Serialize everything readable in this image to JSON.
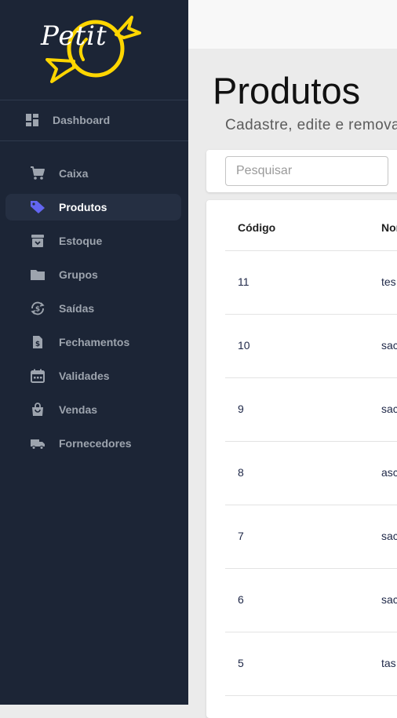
{
  "colors": {
    "sidebar_bg": "#1c2536",
    "accent": "#6366f1",
    "logo_yellow": "#ffd600",
    "active_bg": "#252f42"
  },
  "brand": {
    "name": "Petit",
    "icon": "candy-logo"
  },
  "sidebar": {
    "dashboard": {
      "label": "Dashboard",
      "icon": "dashboard-icon"
    },
    "items": [
      {
        "label": "Caixa",
        "icon": "cart-icon",
        "active": false
      },
      {
        "label": "Produtos",
        "icon": "tag-icon",
        "active": true
      },
      {
        "label": "Estoque",
        "icon": "archive-icon",
        "active": false
      },
      {
        "label": "Grupos",
        "icon": "folder-icon",
        "active": false
      },
      {
        "label": "Saídas",
        "icon": "currency-exchange-icon",
        "active": false
      },
      {
        "label": "Fechamentos",
        "icon": "invoice-icon",
        "active": false
      },
      {
        "label": "Validades",
        "icon": "calendar-icon",
        "active": false
      },
      {
        "label": "Vendas",
        "icon": "shopping-bag-icon",
        "active": false
      },
      {
        "label": "Fornecedores",
        "icon": "truck-icon",
        "active": false
      }
    ]
  },
  "page": {
    "title": "Produtos",
    "subtitle": "Cadastre, edite e remova"
  },
  "search": {
    "placeholder": "Pesquisar",
    "value": ""
  },
  "table": {
    "columns": [
      "Código",
      "Nor"
    ],
    "rows": [
      [
        "11",
        "tes"
      ],
      [
        "10",
        "sac"
      ],
      [
        "9",
        "sac"
      ],
      [
        "8",
        "asc"
      ],
      [
        "7",
        "sac"
      ],
      [
        "6",
        "sac"
      ],
      [
        "5",
        "tas"
      ]
    ]
  }
}
